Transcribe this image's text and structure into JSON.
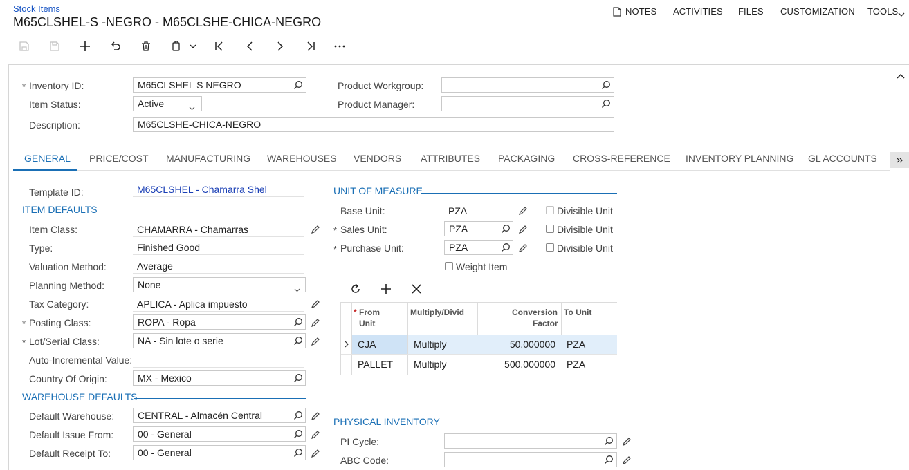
{
  "header": {
    "breadcrumb": "Stock Items",
    "title": "M65CLSHEL-S -NEGRO - M65CLSHE-CHICA-NEGRO",
    "menu": [
      "NOTES",
      "ACTIVITIES",
      "FILES",
      "CUSTOMIZATION",
      "TOOLS"
    ]
  },
  "summary": {
    "inventory_id_label": "Inventory ID:",
    "inventory_id_value": "M65CLSHEL S   NEGRO",
    "item_status_label": "Item Status:",
    "item_status_value": "Active",
    "description_label": "Description:",
    "description_value": "M65CLSHE-CHICA-NEGRO",
    "product_workgroup_label": "Product Workgroup:",
    "product_workgroup_value": "",
    "product_manager_label": "Product Manager:",
    "product_manager_value": ""
  },
  "tabs": [
    "GENERAL",
    "PRICE/COST",
    "MANUFACTURING",
    "WAREHOUSES",
    "VENDORS",
    "ATTRIBUTES",
    "PACKAGING",
    "CROSS-REFERENCE",
    "INVENTORY PLANNING",
    "GL ACCOUNTS"
  ],
  "general": {
    "template_id_label": "Template ID:",
    "template_id_value": "M65CLSHEL - Chamarra Shel",
    "item_defaults_title": "ITEM DEFAULTS",
    "item_class_label": "Item Class:",
    "item_class_value": "CHAMARRA - Chamarras",
    "type_label": "Type:",
    "type_value": "Finished Good",
    "valuation_label": "Valuation Method:",
    "valuation_value": "Average",
    "planning_label": "Planning Method:",
    "planning_value": "None",
    "tax_label": "Tax Category:",
    "tax_value": "APLICA - Aplica impuesto",
    "posting_label": "Posting Class:",
    "posting_value": "ROPA - Ropa",
    "lot_label": "Lot/Serial Class:",
    "lot_value": "NA - Sin lote o serie",
    "auto_inc_label": "Auto-Incremental Value:",
    "auto_inc_value": "",
    "country_label": "Country Of Origin:",
    "country_value": "MX - Mexico",
    "warehouse_defaults_title": "WAREHOUSE DEFAULTS",
    "default_wh_label": "Default Warehouse:",
    "default_wh_value": "CENTRAL - Almacén Central",
    "issue_from_label": "Default Issue From:",
    "issue_from_value": "00 - General",
    "receipt_to_label": "Default Receipt To:",
    "receipt_to_value": "00 - General"
  },
  "uom": {
    "title": "UNIT OF MEASURE",
    "base_label": "Base Unit:",
    "base_value": "PZA",
    "sales_label": "Sales Unit:",
    "sales_value": "PZA",
    "purchase_label": "Purchase Unit:",
    "purchase_value": "PZA",
    "divisible_label": "Divisible Unit",
    "weight_label": "Weight Item",
    "grid_headers": {
      "from": "From Unit",
      "mult": "Multiply/Divid",
      "factor_1": "Conversion",
      "factor_2": "Factor",
      "to": "To Unit",
      "from_1": "From",
      "from_2": "Unit"
    },
    "rows": [
      {
        "from": "CJA",
        "mult": "Multiply",
        "factor": "50.000000",
        "to": "PZA"
      },
      {
        "from": "PALLET",
        "mult": "Multiply",
        "factor": "500.000000",
        "to": "PZA"
      }
    ]
  },
  "physical": {
    "title": "PHYSICAL INVENTORY",
    "pi_label": "PI Cycle:",
    "pi_value": "",
    "abc_label": "ABC Code:",
    "abc_value": ""
  },
  "colors": {
    "accent": "#1a6fb5",
    "link": "#1a3fb5",
    "selected_row": "#e1eefa"
  }
}
